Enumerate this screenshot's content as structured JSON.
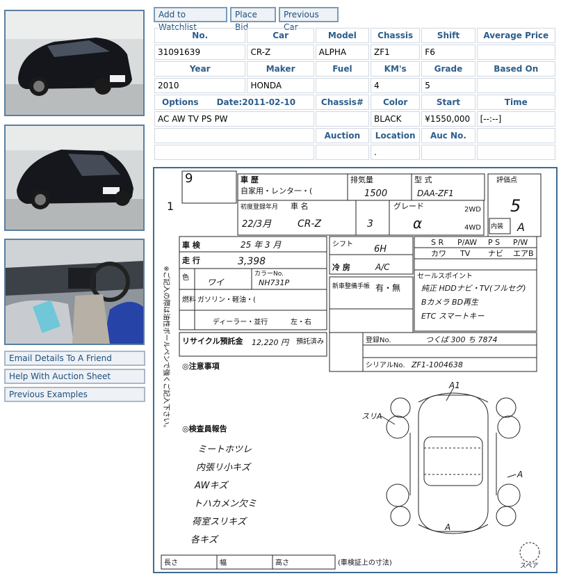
{
  "toolbar": {
    "watchlist": "Add to Watchlist",
    "place_bid": "Place Bid",
    "previous_car": "Previous Car"
  },
  "sidebar": {
    "links": [
      "Email Details To A Friend",
      "Help With Auction Sheet",
      "Previous Examples"
    ]
  },
  "info": {
    "headers1": [
      "No.",
      "Car",
      "Model",
      "Chassis",
      "Shift",
      "Average Price"
    ],
    "row1": [
      "31091639",
      "CR-Z",
      "ALPHA",
      "ZF1",
      "F6",
      ""
    ],
    "headers2": [
      "Year",
      "Maker",
      "Fuel",
      "KM's",
      "Grade",
      "Based On"
    ],
    "row2": [
      "2010",
      "HONDA",
      "",
      "4",
      "5",
      ""
    ],
    "options_label": "Options",
    "date_label": "Date:2011-02-10",
    "headers3": [
      "Chassis#",
      "Color",
      "Start",
      "Time"
    ],
    "options_value": "AC AW TV PS PW",
    "row3": [
      "",
      "BLACK",
      "¥1550,000",
      "[--:--]"
    ],
    "headers4": [
      "Auction",
      "Location",
      "Auc No."
    ],
    "row4": [
      "",
      ".",
      ""
    ]
  },
  "sheet": {
    "history_label": "車 歴",
    "usage": "自家用・レンタ一・(",
    "displacement_label": "排気量",
    "displacement_value": "1500",
    "model_label": "型 式",
    "model_value": "DAA-ZF1",
    "score_label": "評価点",
    "score_value": "5",
    "interior_label": "内装",
    "interior_value": "A",
    "first_reg_label": "初度登録年月",
    "first_reg_value": "22/3月",
    "name_label": "車 名",
    "name_value": "CR-Z",
    "doors_value": "3",
    "grade_label": "グレード",
    "grade_value": "α",
    "drive_2wd": "2WD",
    "drive_4wd": "4WD",
    "inspection_label": "車 検",
    "inspection_value": "25 年 3 月",
    "mileage_label": "走 行",
    "mileage_value": "3,398",
    "shift_label": "シフト",
    "shift_value": "6H",
    "ac_label": "冷 房",
    "ac_value": "A/C",
    "equip_row1": [
      "S R",
      "P/AW",
      "P S",
      "P/W"
    ],
    "equip_row2": [
      "カワ",
      "TV",
      "ナビ",
      "エアB"
    ],
    "color_label": "色",
    "color_value": "ワイ",
    "color_code_label": "カラーNo.",
    "color_code": "NH731P",
    "fuel_label": "燃料",
    "fuel_value": "ガソリン・軽油・(",
    "warranty_label": "新車整備手帳",
    "warranty_value": "有・無",
    "sales_points_label": "セールスポイント",
    "sales_points": [
      "純正 HDDナビ・TV(フルセグ)",
      "Bカメラ BD再生",
      "ETC スマートキー"
    ],
    "dealer_value": "ディーラー・並行",
    "steering_value": "左・右",
    "recycle_label": "リサイクル預託金",
    "recycle_value": "12,220 円",
    "recycle_status": "預託済み",
    "reg_no_label": "登録No.",
    "reg_no_value": "つくば 300 ち 7874",
    "serial_label": "シリアルNo.",
    "serial_value": "ZF1-1004638",
    "notes_label": "◎注意事項",
    "inspector_label": "◎検査員報告",
    "inspector_notes": [
      "ミートホツレ",
      "内張リ小キズ",
      "AWキズ",
      "トハカメン欠ミ",
      "荷室スリキズ",
      "各キズ"
    ],
    "side_note": "※ご記入の際は油性ボールペンで強くご記入下さい。",
    "length_label": "長さ",
    "width_label": "幅",
    "height_label": "高さ",
    "dims_note": "(車検証上の寸法)",
    "spare_label": "スペア",
    "damage_marks": [
      "A1",
      "A",
      "A",
      "スリA"
    ]
  }
}
